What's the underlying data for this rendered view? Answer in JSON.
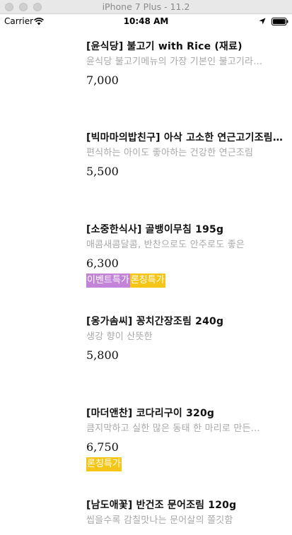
{
  "window": {
    "title": "iPhone 7 Plus - 11.2"
  },
  "status_bar": {
    "carrier": "Carrier",
    "time": "10:48 AM"
  },
  "colors": {
    "event_badge": "#c283d8",
    "bundle_badge": "#f5c518"
  },
  "products": [
    {
      "name": "[윤식당] 불고기 with Rice (재료)",
      "description": "윤식당 불고기메뉴의 가장 기본인 불고기라…",
      "price": "7,000",
      "badges": []
    },
    {
      "name": "[빅마마의밥친구] 아삭 고소한 연근고기조림…",
      "description": "편식하는 아이도 좋아하는 건강한 연근조림",
      "price": "5,500",
      "badges": []
    },
    {
      "name": "[소중한식사] 골뱅이무침 195g",
      "description": "매콤새콤달콤, 반찬으로도 안주로도 좋은",
      "price": "6,300",
      "badges": [
        {
          "label": "이벤트특가",
          "kind": "event"
        },
        {
          "label": "론칭특가",
          "kind": "launch"
        }
      ]
    },
    {
      "name": "[옹가솜씨] 꽁치간장조림 240g",
      "description": "생강 향이 산뜻한",
      "price": "5,800",
      "badges": []
    },
    {
      "name": "[마더앤찬] 코다리구이 320g",
      "description": "큼지막하고 실한 많은 동태 한 마리로 만든…",
      "price": "6,750",
      "badges": [
        {
          "label": "론칭특가",
          "kind": "launch"
        }
      ]
    },
    {
      "name": "[남도애꽃] 반건조 문어조림 120g",
      "description": "씹을수록 감칠맛나는 문어살의 쫄깃함",
      "price": "",
      "badges": []
    }
  ]
}
